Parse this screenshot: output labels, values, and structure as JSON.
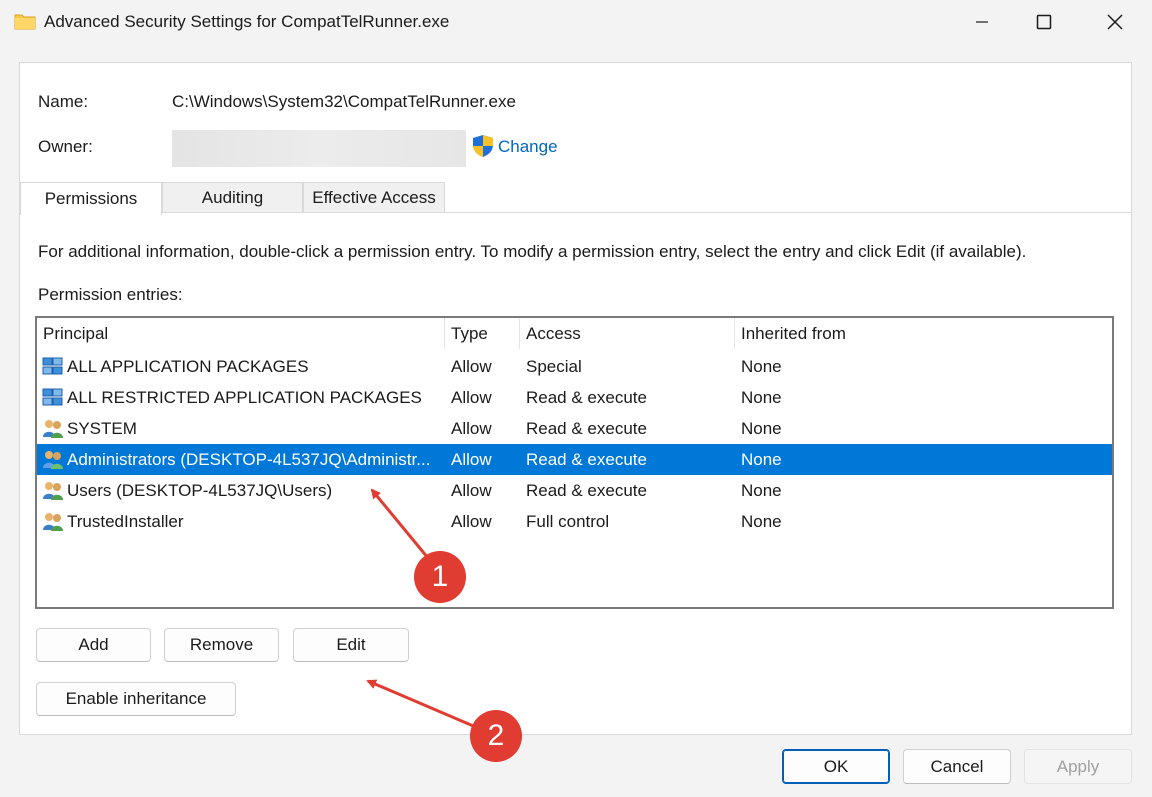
{
  "window": {
    "title": "Advanced Security Settings for CompatTelRunner.exe"
  },
  "header": {
    "name_label": "Name:",
    "name_value": "C:\\Windows\\System32\\CompatTelRunner.exe",
    "owner_label": "Owner:",
    "change_label": "Change"
  },
  "tabs": [
    {
      "label": "Permissions",
      "active": true
    },
    {
      "label": "Auditing",
      "active": false
    },
    {
      "label": "Effective Access",
      "active": false
    }
  ],
  "info_text": "For additional information, double-click a permission entry. To modify a permission entry, select the entry and click Edit (if available).",
  "entries_label": "Permission entries:",
  "table": {
    "columns": [
      "Principal",
      "Type",
      "Access",
      "Inherited from"
    ],
    "rows": [
      {
        "icon": "app-packages-icon",
        "principal": "ALL APPLICATION PACKAGES",
        "type": "Allow",
        "access": "Special",
        "inherited": "None",
        "selected": false
      },
      {
        "icon": "app-packages-icon",
        "principal": "ALL RESTRICTED APPLICATION PACKAGES",
        "type": "Allow",
        "access": "Read & execute",
        "inherited": "None",
        "selected": false
      },
      {
        "icon": "users-group-icon",
        "principal": "SYSTEM",
        "type": "Allow",
        "access": "Read & execute",
        "inherited": "None",
        "selected": false
      },
      {
        "icon": "users-group-icon",
        "principal": "Administrators (DESKTOP-4L537JQ\\Administr...",
        "type": "Allow",
        "access": "Read & execute",
        "inherited": "None",
        "selected": true
      },
      {
        "icon": "users-group-icon",
        "principal": "Users (DESKTOP-4L537JQ\\Users)",
        "type": "Allow",
        "access": "Read & execute",
        "inherited": "None",
        "selected": false
      },
      {
        "icon": "users-group-icon",
        "principal": "TrustedInstaller",
        "type": "Allow",
        "access": "Full control",
        "inherited": "None",
        "selected": false
      }
    ]
  },
  "buttons": {
    "add": "Add",
    "remove": "Remove",
    "edit": "Edit",
    "enable_inheritance": "Enable inheritance",
    "ok": "OK",
    "cancel": "Cancel",
    "apply": "Apply"
  },
  "annotations": {
    "marker_1": "1",
    "marker_2": "2",
    "color": "#e03c31"
  },
  "colors": {
    "selection": "#0078d7",
    "link": "#0067c0",
    "window_bg": "#f3f3f3"
  }
}
